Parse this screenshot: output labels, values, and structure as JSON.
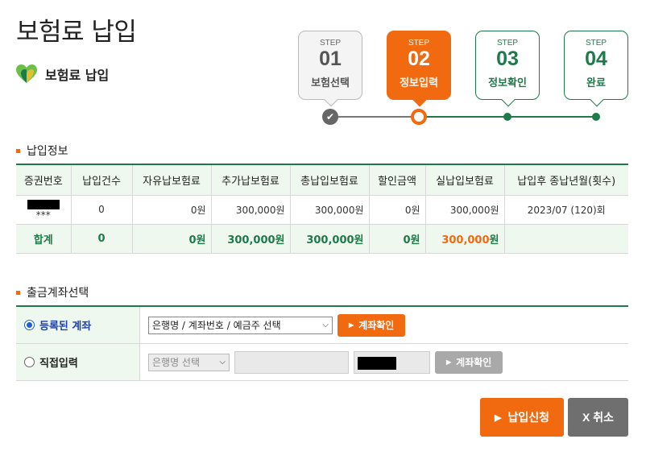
{
  "page": {
    "title": "보험료 납입",
    "subtitle": "보험료 납입"
  },
  "steps": [
    {
      "label": "STEP",
      "num": "01",
      "name": "보험선택",
      "state": "done"
    },
    {
      "label": "STEP",
      "num": "02",
      "name": "정보입력",
      "state": "active"
    },
    {
      "label": "STEP",
      "num": "03",
      "name": "정보확인",
      "state": "future"
    },
    {
      "label": "STEP",
      "num": "04",
      "name": "완료",
      "state": "future"
    }
  ],
  "payment_info": {
    "heading": "납입정보",
    "columns": [
      "증권번호",
      "납입건수",
      "자유납보험료",
      "추가납보험료",
      "총납입보험료",
      "할인금액",
      "실납입보험료",
      "납입후 종납년월(횟수)"
    ],
    "row": {
      "policy_suffix": "***",
      "count": "0",
      "free": "0원",
      "extra": "300,000원",
      "total": "300,000원",
      "discount": "0원",
      "actual": "300,000원",
      "final_month": "2023/07 (120)회"
    },
    "sum": {
      "label": "합계",
      "count": "0",
      "free": "0원",
      "extra": "300,000원",
      "total": "300,000원",
      "discount": "0원",
      "actual_num": "300,000",
      "actual_unit": "원"
    }
  },
  "account": {
    "heading": "출금계좌선택",
    "registered_label": "등록된 계좌",
    "registered_select": "은행명 / 계좌번호 / 예금주 선택",
    "confirm_label": "계좌확인",
    "direct_label": "직접입력",
    "bank_select": "은행명 선택",
    "confirm_label_disabled": "계좌확인"
  },
  "actions": {
    "submit_label": "납입신청",
    "cancel_label": "X 취소"
  },
  "colors": {
    "accent": "#f26a10",
    "brand_green": "#1f7a4a",
    "table_bg": "#eef8ee"
  }
}
